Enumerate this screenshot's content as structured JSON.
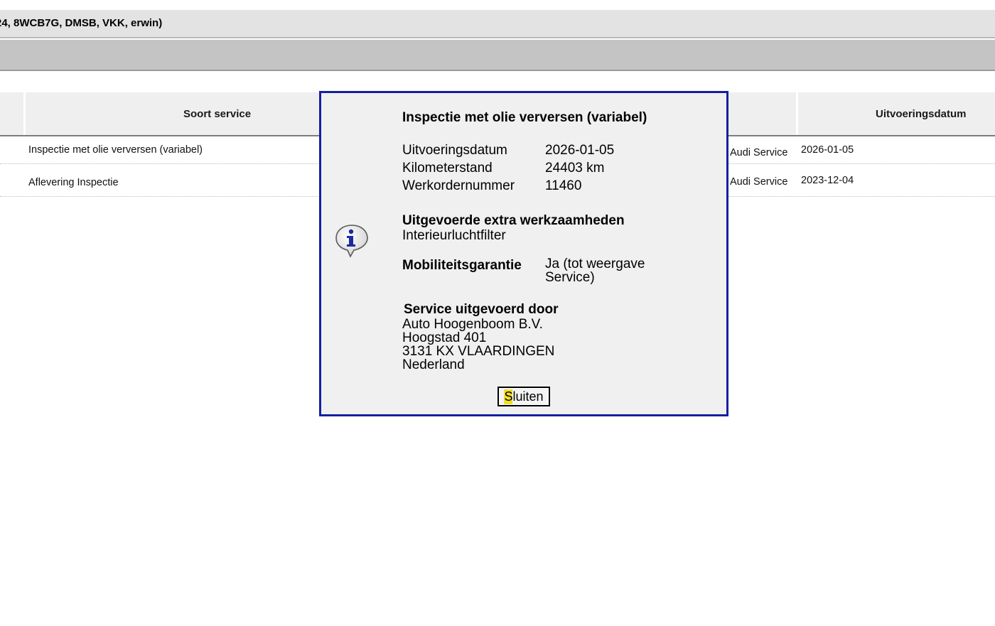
{
  "window": {
    "title": "24, 8WCB7G, DMSB, VKK, erwin)"
  },
  "table": {
    "headers": {
      "service_type": "Soort service",
      "execution_date": "Uitvoeringsdatum"
    },
    "rows": [
      {
        "service_type": "Inspectie met olie verversen (variabel)",
        "provider": "Audi Service",
        "date": "2026-01-05"
      },
      {
        "service_type": "Aflevering Inspectie",
        "provider": "Audi Service",
        "date": "2023-12-04"
      }
    ]
  },
  "dialog": {
    "icon": "info-speech-bubble-icon",
    "title": "Inspectie met olie verversen (variabel)",
    "details": [
      {
        "label": "Uitvoeringsdatum",
        "value": "2026-01-05"
      },
      {
        "label": "Kilometerstand",
        "value": "24403 km"
      },
      {
        "label": "Werkordernummer",
        "value": "11460"
      }
    ],
    "extra_work_heading": "Uitgevoerde extra werkzaamheden",
    "extra_work_value": "Interieurluchtfilter",
    "mobility_label": "Mobiliteitsgarantie",
    "mobility_value": "Ja (tot weergave Service)",
    "performed_by_heading": "Service uitgevoerd door",
    "address": {
      "name": "Auto Hoogenboom B.V.",
      "street": "Hoogstad 401",
      "city": "3131 KX VLAARDINGEN",
      "country": "Nederland"
    },
    "close_button": {
      "first": "S",
      "rest": "luiten"
    }
  },
  "colors": {
    "dialog_border": "#1420a0",
    "highlight": "#f2dd2a"
  }
}
